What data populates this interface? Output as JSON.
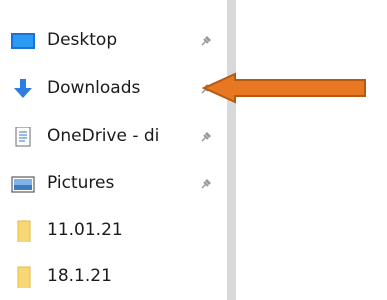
{
  "nav": {
    "items": [
      {
        "label": "Desktop",
        "icon": "desktop-icon",
        "pinned": true
      },
      {
        "label": "Downloads",
        "icon": "downloads-arrow-icon",
        "pinned": true
      },
      {
        "label": "OneDrive - di",
        "icon": "document-icon",
        "pinned": true
      },
      {
        "label": "Pictures",
        "icon": "pictures-icon",
        "pinned": true
      },
      {
        "label": "11.01.21",
        "icon": "folder-icon",
        "pinned": false
      },
      {
        "label": "18.1.21",
        "icon": "folder-icon",
        "pinned": false
      }
    ]
  },
  "colors": {
    "arrow": "#e87722",
    "arrow_outline": "#b55a10",
    "folder": "#f8d775",
    "desktop": "#1e90ff",
    "download": "#2f7de1"
  }
}
